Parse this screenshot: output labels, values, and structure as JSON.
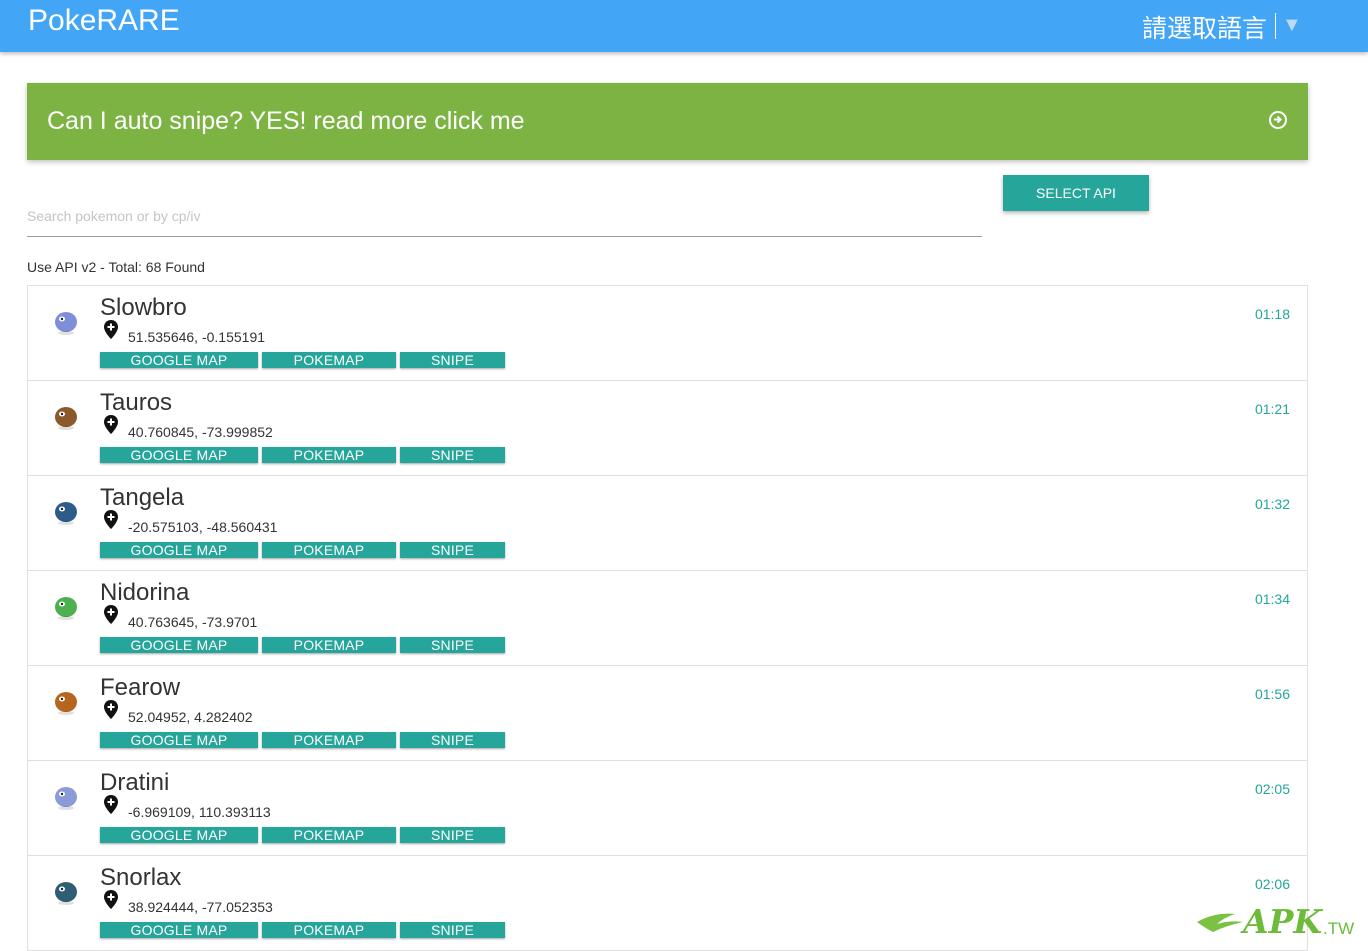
{
  "header": {
    "brand": "PokeRARE",
    "language_placeholder": "請選取語言",
    "language_arrow": "▼"
  },
  "banner": {
    "text": "Can I auto snipe? YES! read more click me",
    "icon": "arrow-circle-right-icon"
  },
  "search": {
    "placeholder": "Search pokemon or by cp/iv",
    "value": ""
  },
  "select_api_label": "SELECT API",
  "status": "Use API v2 - Total: 68 Found",
  "buttons": {
    "google_map": "GOOGLE MAP",
    "pokemap": "POKEMAP",
    "snipe": "SNIPE"
  },
  "pokemon": [
    {
      "name": "Slowbro",
      "coords": "51.535646, -0.155191",
      "time": "01:18",
      "color": "#7e8fd8"
    },
    {
      "name": "Tauros",
      "coords": "40.760845, -73.999852",
      "time": "01:21",
      "color": "#8a5a2b"
    },
    {
      "name": "Tangela",
      "coords": "-20.575103, -48.560431",
      "time": "01:32",
      "color": "#2d5b8a"
    },
    {
      "name": "Nidorina",
      "coords": "40.763645, -73.9701",
      "time": "01:34",
      "color": "#4caf50"
    },
    {
      "name": "Fearow",
      "coords": "52.04952, 4.282402",
      "time": "01:56",
      "color": "#b5651d"
    },
    {
      "name": "Dratini",
      "coords": "-6.969109, 110.393113",
      "time": "02:05",
      "color": "#8c9ad8"
    },
    {
      "name": "Snorlax",
      "coords": "38.924444, -77.052353",
      "time": "02:06",
      "color": "#2f5d73"
    }
  ],
  "watermark": {
    "text": "APK",
    "suffix": ".TW"
  }
}
